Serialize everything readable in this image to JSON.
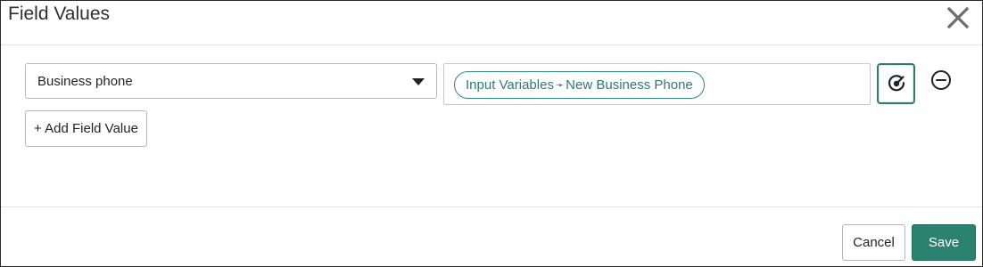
{
  "dialog": {
    "title": "Field Values"
  },
  "field_row": {
    "field_select": {
      "selected": "Business phone"
    },
    "value_pill": {
      "source": "Input Variables",
      "separator": "➛",
      "target": "New Business Phone"
    },
    "pick_icon": "data-pill-picker-icon",
    "remove_icon": "minus-circle-icon"
  },
  "add_field_value_label": "+ Add Field Value",
  "footer": {
    "cancel_label": "Cancel",
    "save_label": "Save"
  },
  "colors": {
    "accent": "#2b8270",
    "pill_text": "#2b7f6a"
  }
}
